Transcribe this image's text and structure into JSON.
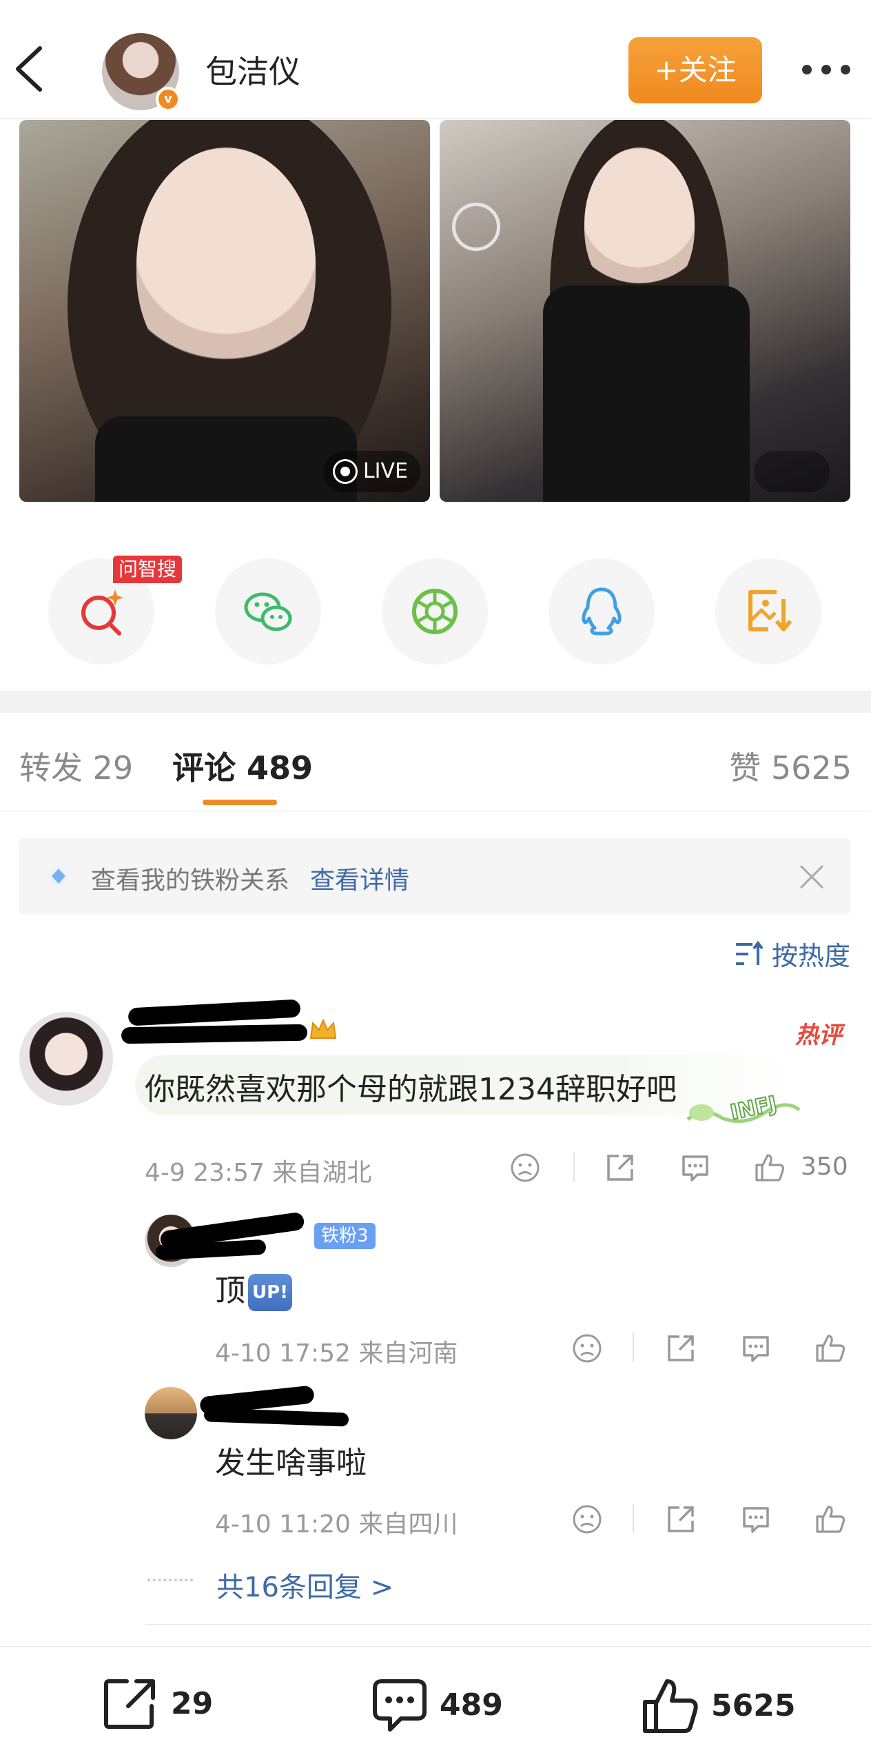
{
  "header": {
    "user_name": "包洁仪",
    "follow_label": "+关注"
  },
  "photos": {
    "live_label": "LIVE"
  },
  "share": {
    "ask_tag": "问智搜"
  },
  "tabs": {
    "repost": "转发 29",
    "comment": "评论 489",
    "like": "赞 5625"
  },
  "fan_bar": {
    "text": "查看我的铁粉关系",
    "link": "查看详情"
  },
  "sort_label": "按热度",
  "comment": {
    "hot_label": "热评",
    "text": "你既然喜欢那个母的就跟1234辞职好吧",
    "meta": "4-9 23:57  来自湖北",
    "likes": "350"
  },
  "replies": [
    {
      "fan_badge": "铁粉3",
      "text": "顶",
      "up_tag": "UP!",
      "meta": "4-10 17:52  来自河南"
    },
    {
      "text": "发生啥事啦",
      "meta": "4-10 11:20  来自四川"
    }
  ],
  "more_replies": "共16条回复 >",
  "bottom": {
    "reposts": "29",
    "comments": "489",
    "likes": "5625"
  },
  "colors": {
    "accent": "#f08a24",
    "link": "#3d6aa6",
    "hot": "#e8483c"
  }
}
